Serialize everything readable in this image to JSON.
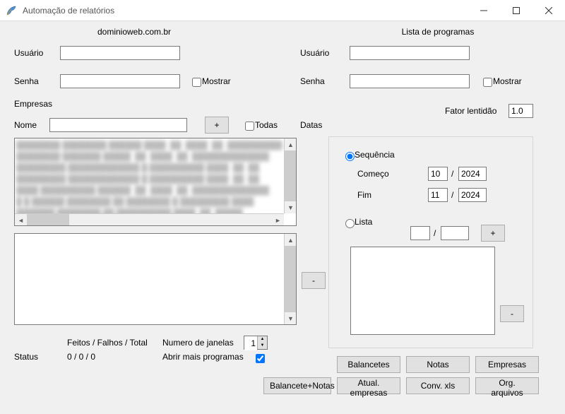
{
  "window": {
    "title": "Automação de relatórios"
  },
  "left": {
    "header": "dominioweb.com.br",
    "usuario_label": "Usuário",
    "senha_label": "Senha",
    "mostrar_label": "Mostrar",
    "empresas_label": "Empresas",
    "nome_label": "Nome",
    "add_btn": "+",
    "todas_label": "Todas",
    "remove_btn": "-",
    "feitos_label": "Feitos / Falhos / Total",
    "status_label": "Status",
    "status_value": "0 / 0 / 0",
    "janelas_label": "Numero de janelas",
    "janelas_value": "1",
    "abrir_label": "Abrir mais programas",
    "balancete_notas_btn": "Balancete+Notas"
  },
  "right": {
    "header": "Lista de programas",
    "usuario_label": "Usuário",
    "senha_label": "Senha",
    "mostrar_label": "Mostrar",
    "fator_label": "Fator lentidão",
    "fator_value": "1.0",
    "datas_label": "Datas",
    "sequencia_label": "Sequência",
    "comeco_label": "Começo",
    "comeco_mes": "10",
    "comeco_ano": "2024",
    "fim_label": "Fim",
    "fim_mes": "11",
    "fim_ano": "2024",
    "lista_label": "Lista",
    "lista_add": "+",
    "lista_remove": "-",
    "slash": "/",
    "buttons": {
      "balancetes": "Balancetes",
      "notas": "Notas",
      "empresas": "Empresas",
      "atual": "Atual. empresas",
      "conv": "Conv. xls",
      "org": "Org. arquivos"
    }
  }
}
